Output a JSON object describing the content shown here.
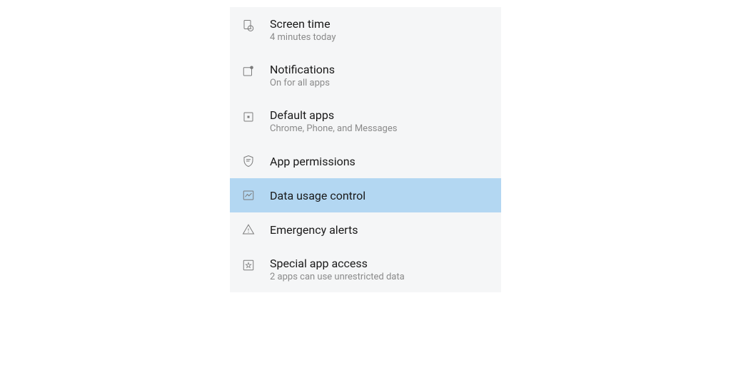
{
  "settings": {
    "items": [
      {
        "title": "Screen time",
        "subtitle": "4 minutes today",
        "icon": "clock",
        "highlighted": false
      },
      {
        "title": "Notifications",
        "subtitle": "On for all apps",
        "icon": "notification",
        "highlighted": false
      },
      {
        "title": "Default apps",
        "subtitle": "Chrome, Phone, and Messages",
        "icon": "default-apps",
        "highlighted": false
      },
      {
        "title": "App permissions",
        "subtitle": null,
        "icon": "shield",
        "highlighted": false
      },
      {
        "title": "Data usage control",
        "subtitle": null,
        "icon": "chart",
        "highlighted": true
      },
      {
        "title": "Emergency alerts",
        "subtitle": null,
        "icon": "alert",
        "highlighted": false
      },
      {
        "title": "Special app access",
        "subtitle": "2 apps can use unrestricted data",
        "icon": "star",
        "highlighted": false
      }
    ]
  }
}
